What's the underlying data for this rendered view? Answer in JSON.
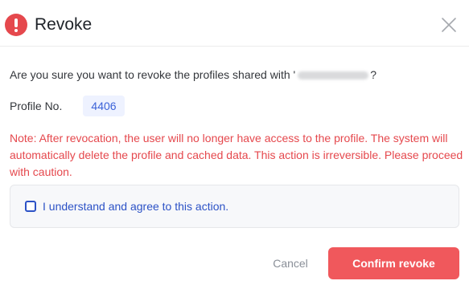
{
  "dialog": {
    "title": "Revoke",
    "header_icon": "warning-icon",
    "close_icon": "close-icon",
    "accent_color": "#e5484d"
  },
  "body": {
    "question_prefix": "Are you sure you want to revoke the profiles shared with '",
    "question_suffix": "?",
    "profile_label": "Profile No.",
    "profile_number": "4406",
    "note": "Note: After revocation, the user will no longer have access to the profile. The system will automatically delete the profile and cached data. This action is irreversible. Please proceed with caution."
  },
  "agreement": {
    "checked": false,
    "label": "I understand and agree to this action."
  },
  "footer": {
    "cancel_label": "Cancel",
    "confirm_label": "Confirm revoke",
    "confirm_color": "#f0585c"
  }
}
